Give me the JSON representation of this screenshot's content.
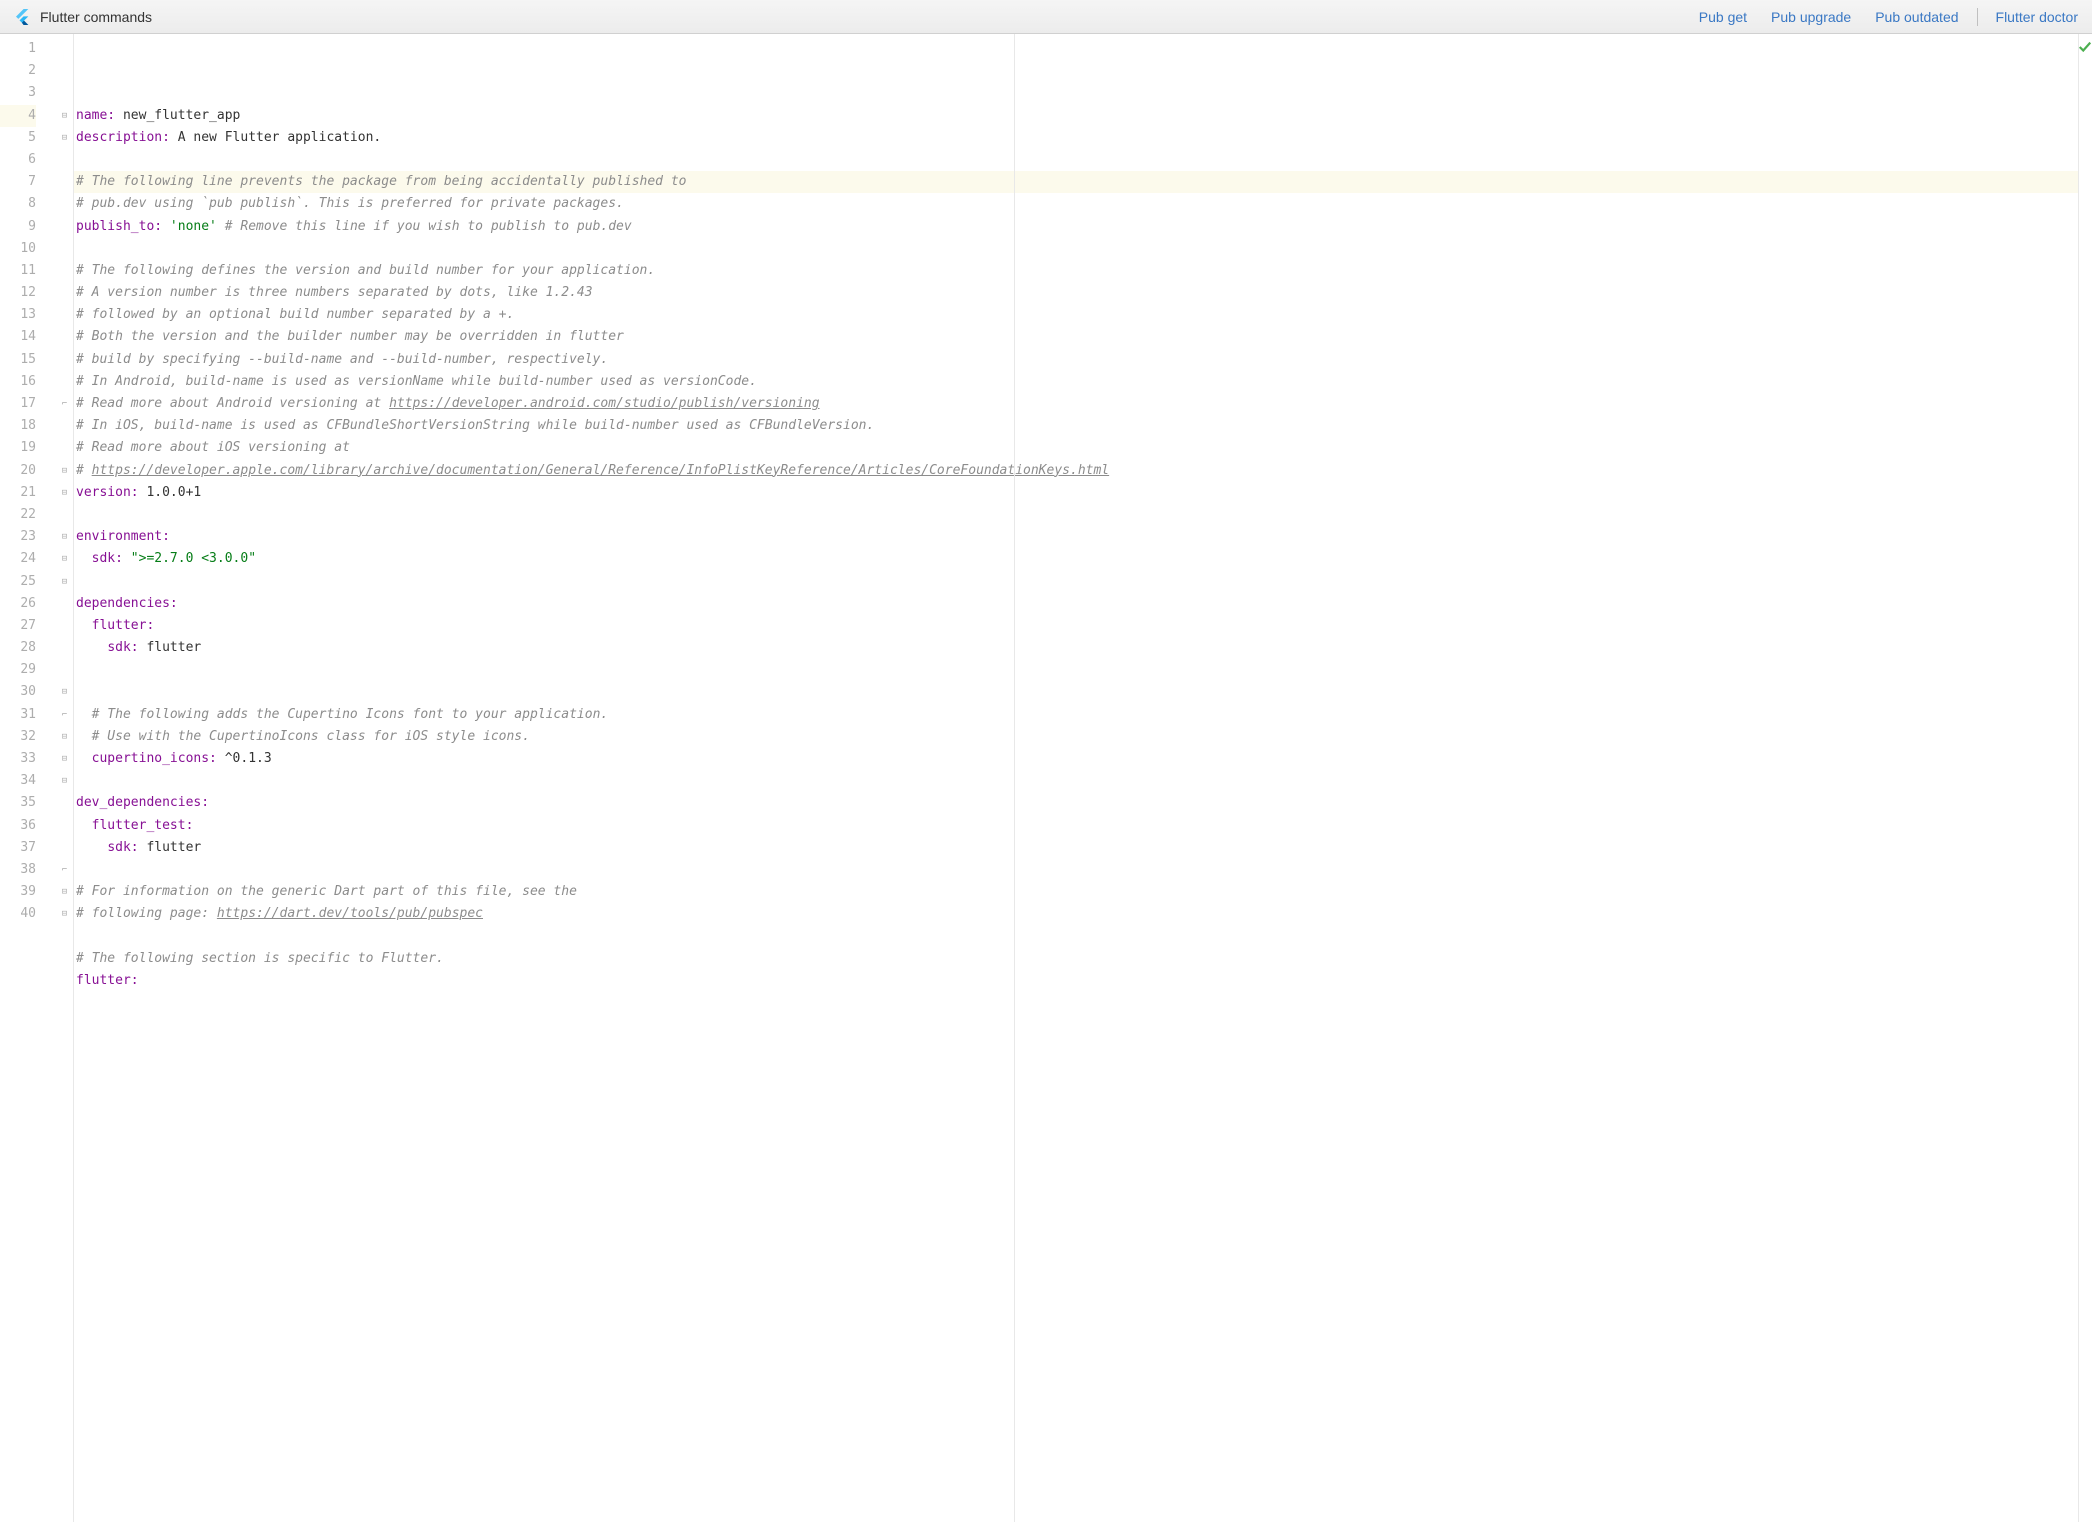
{
  "toolbar": {
    "title": "Flutter commands",
    "links": [
      "Pub get",
      "Pub upgrade",
      "Pub outdated",
      "Flutter doctor"
    ]
  },
  "gutter": {
    "start": 1,
    "end": 40,
    "highlighted": 4
  },
  "fold_markers": {
    "4": "open",
    "5": "open-close",
    "17": "close",
    "20": "open",
    "21": "open-close",
    "23": "open",
    "24": "open",
    "25": "open-close",
    "30": "open-close",
    "31": "close",
    "32": "open",
    "33": "open",
    "34": "open-close",
    "38": "close",
    "39": "open",
    "40": "open"
  },
  "code": {
    "l1": {
      "k": "name:",
      "v": " new_flutter_app"
    },
    "l2": {
      "k": "description:",
      "v": " A new Flutter application."
    },
    "l3": {
      "blank": true
    },
    "l4": {
      "c": "# The following line prevents the package from being accidentally published to"
    },
    "l5": {
      "c": "# pub.dev using `pub publish`. This is preferred for private packages."
    },
    "l6": {
      "k": "publish_to:",
      "s": " 'none'",
      "c": " # Remove this line if you wish to publish to pub.dev"
    },
    "l7": {
      "blank": true
    },
    "l8": {
      "c": "# The following defines the version and build number for your application."
    },
    "l9": {
      "c": "# A version number is three numbers separated by dots, like 1.2.43"
    },
    "l10": {
      "c": "# followed by an optional build number separated by a +."
    },
    "l11": {
      "c": "# Both the version and the builder number may be overridden in flutter"
    },
    "l12": {
      "c": "# build by specifying --build-name and --build-number, respectively."
    },
    "l13": {
      "c": "# In Android, build-name is used as versionName while build-number used as versionCode."
    },
    "l14": {
      "c_pre": "# Read more about Android versioning at ",
      "link": "https://developer.android.com/studio/publish/versioning"
    },
    "l15": {
      "c": "# In iOS, build-name is used as CFBundleShortVersionString while build-number used as CFBundleVersion."
    },
    "l16": {
      "c": "# Read more about iOS versioning at"
    },
    "l17": {
      "c_pre": "# ",
      "link": "https://developer.apple.com/library/archive/documentation/General/Reference/InfoPlistKeyReference/Articles/CoreFoundationKeys.html"
    },
    "l18": {
      "k": "version:",
      "v": " 1.0.0+1"
    },
    "l19": {
      "blank": true
    },
    "l20": {
      "k": "environment:"
    },
    "l21": {
      "indent": "  ",
      "k": "sdk:",
      "s": " \">=2.7.0 <3.0.0\""
    },
    "l22": {
      "blank": true
    },
    "l23": {
      "k": "dependencies:"
    },
    "l24": {
      "indent": "  ",
      "k": "flutter:"
    },
    "l25": {
      "indent": "    ",
      "k": "sdk:",
      "v": " flutter"
    },
    "l26": {
      "blank": true
    },
    "l27": {
      "blank": true
    },
    "l28": {
      "indent": "  ",
      "c": "# The following adds the Cupertino Icons font to your application."
    },
    "l29": {
      "indent": "  ",
      "c": "# Use with the CupertinoIcons class for iOS style icons."
    },
    "l30": {
      "indent": "  ",
      "k": "cupertino_icons:",
      "v": " ^0.1.3"
    },
    "l31": {
      "blank": true
    },
    "l32": {
      "k": "dev_dependencies:"
    },
    "l33": {
      "indent": "  ",
      "k": "flutter_test:"
    },
    "l34": {
      "indent": "    ",
      "k": "sdk:",
      "v": " flutter"
    },
    "l35": {
      "blank": true
    },
    "l36": {
      "c": "# For information on the generic Dart part of this file, see the"
    },
    "l37": {
      "c_pre": "# following page: ",
      "link": "https://dart.dev/tools/pub/pubspec"
    },
    "l38": {
      "blank": true
    },
    "l39": {
      "c": "# The following section is specific to Flutter."
    },
    "l40": {
      "k": "flutter:"
    }
  }
}
